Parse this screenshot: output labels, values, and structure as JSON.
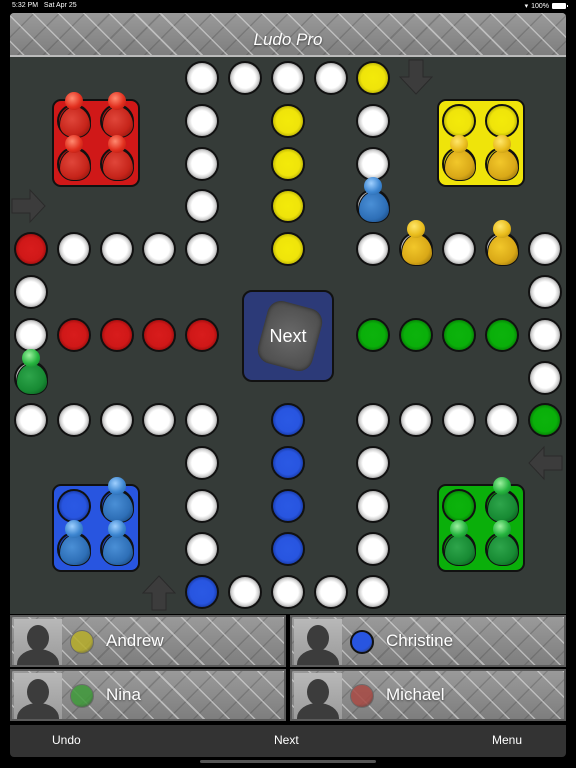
{
  "status_bar": {
    "time": "5:32 PM",
    "date": "Sat Apr 25",
    "battery": "100%",
    "wifi_icon": "wifi-icon",
    "battery_icon": "battery-icon"
  },
  "app": {
    "title": "Ludo Pro"
  },
  "colors": {
    "red": "#d01818",
    "yellow": "#efe40a",
    "green": "#0aaf0a",
    "blue": "#2855e0",
    "white": "#ffffff",
    "board": "#353b38",
    "dice_box": "#2c3a78"
  },
  "board": {
    "grid_size": 13,
    "cells": [
      {
        "col": 4,
        "row": 0,
        "color": "w"
      },
      {
        "col": 5,
        "row": 0,
        "color": "w"
      },
      {
        "col": 6,
        "row": 0,
        "color": "w"
      },
      {
        "col": 7,
        "row": 0,
        "color": "w"
      },
      {
        "col": 8,
        "row": 0,
        "color": "y"
      },
      {
        "col": 4,
        "row": 1,
        "color": "w"
      },
      {
        "col": 6,
        "row": 1,
        "color": "y"
      },
      {
        "col": 8,
        "row": 1,
        "color": "w"
      },
      {
        "col": 4,
        "row": 2,
        "color": "w"
      },
      {
        "col": 6,
        "row": 2,
        "color": "y"
      },
      {
        "col": 8,
        "row": 2,
        "color": "w"
      },
      {
        "col": 4,
        "row": 3,
        "color": "w"
      },
      {
        "col": 6,
        "row": 3,
        "color": "y"
      },
      {
        "col": 8,
        "row": 3,
        "color": "w"
      },
      {
        "col": 0,
        "row": 4,
        "color": "r"
      },
      {
        "col": 1,
        "row": 4,
        "color": "w"
      },
      {
        "col": 2,
        "row": 4,
        "color": "w"
      },
      {
        "col": 3,
        "row": 4,
        "color": "w"
      },
      {
        "col": 4,
        "row": 4,
        "color": "w"
      },
      {
        "col": 6,
        "row": 4,
        "color": "y"
      },
      {
        "col": 8,
        "row": 4,
        "color": "w"
      },
      {
        "col": 9,
        "row": 4,
        "color": "w"
      },
      {
        "col": 10,
        "row": 4,
        "color": "w"
      },
      {
        "col": 11,
        "row": 4,
        "color": "w"
      },
      {
        "col": 12,
        "row": 4,
        "color": "w"
      },
      {
        "col": 0,
        "row": 5,
        "color": "w"
      },
      {
        "col": 12,
        "row": 5,
        "color": "w"
      },
      {
        "col": 0,
        "row": 6,
        "color": "w"
      },
      {
        "col": 1,
        "row": 6,
        "color": "r"
      },
      {
        "col": 2,
        "row": 6,
        "color": "r"
      },
      {
        "col": 3,
        "row": 6,
        "color": "r"
      },
      {
        "col": 4,
        "row": 6,
        "color": "r"
      },
      {
        "col": 8,
        "row": 6,
        "color": "g"
      },
      {
        "col": 9,
        "row": 6,
        "color": "g"
      },
      {
        "col": 10,
        "row": 6,
        "color": "g"
      },
      {
        "col": 11,
        "row": 6,
        "color": "g"
      },
      {
        "col": 12,
        "row": 6,
        "color": "w"
      },
      {
        "col": 0,
        "row": 7,
        "color": "w"
      },
      {
        "col": 12,
        "row": 7,
        "color": "w"
      },
      {
        "col": 0,
        "row": 8,
        "color": "w"
      },
      {
        "col": 1,
        "row": 8,
        "color": "w"
      },
      {
        "col": 2,
        "row": 8,
        "color": "w"
      },
      {
        "col": 3,
        "row": 8,
        "color": "w"
      },
      {
        "col": 4,
        "row": 8,
        "color": "w"
      },
      {
        "col": 6,
        "row": 8,
        "color": "b"
      },
      {
        "col": 8,
        "row": 8,
        "color": "w"
      },
      {
        "col": 9,
        "row": 8,
        "color": "w"
      },
      {
        "col": 10,
        "row": 8,
        "color": "w"
      },
      {
        "col": 11,
        "row": 8,
        "color": "w"
      },
      {
        "col": 12,
        "row": 8,
        "color": "g"
      },
      {
        "col": 4,
        "row": 9,
        "color": "w"
      },
      {
        "col": 6,
        "row": 9,
        "color": "b"
      },
      {
        "col": 8,
        "row": 9,
        "color": "w"
      },
      {
        "col": 4,
        "row": 10,
        "color": "w"
      },
      {
        "col": 6,
        "row": 10,
        "color": "b"
      },
      {
        "col": 8,
        "row": 10,
        "color": "w"
      },
      {
        "col": 4,
        "row": 11,
        "color": "w"
      },
      {
        "col": 6,
        "row": 11,
        "color": "b"
      },
      {
        "col": 8,
        "row": 11,
        "color": "w"
      },
      {
        "col": 4,
        "row": 12,
        "color": "b"
      },
      {
        "col": 5,
        "row": 12,
        "color": "w"
      },
      {
        "col": 6,
        "row": 12,
        "color": "w"
      },
      {
        "col": 7,
        "row": 12,
        "color": "w"
      },
      {
        "col": 8,
        "row": 12,
        "color": "w"
      }
    ],
    "houses": [
      {
        "color": "red",
        "col": 1,
        "row": 1,
        "slots": [
          "r",
          "r",
          "r",
          "r"
        ]
      },
      {
        "color": "yellow",
        "col": 10,
        "row": 1,
        "slots": [
          "y",
          "y",
          "y",
          "y"
        ]
      },
      {
        "color": "blue",
        "col": 1,
        "row": 10,
        "slots": [
          "b",
          "b",
          "b",
          "b"
        ]
      },
      {
        "color": "green",
        "col": 10,
        "row": 10,
        "slots": [
          "g",
          "g",
          "g",
          "g"
        ]
      }
    ],
    "pawns": [
      {
        "color": "red",
        "col": 1,
        "row": 1
      },
      {
        "color": "red",
        "col": 2,
        "row": 1
      },
      {
        "color": "red",
        "col": 1,
        "row": 2
      },
      {
        "color": "red",
        "col": 2,
        "row": 2
      },
      {
        "color": "yellow",
        "col": 10,
        "row": 2
      },
      {
        "color": "yellow",
        "col": 11,
        "row": 2
      },
      {
        "color": "yellow",
        "col": 9,
        "row": 4
      },
      {
        "color": "yellow",
        "col": 11,
        "row": 4
      },
      {
        "color": "blue",
        "col": 8,
        "row": 3
      },
      {
        "color": "green",
        "col": 0,
        "row": 7
      },
      {
        "color": "blue",
        "col": 2,
        "row": 10
      },
      {
        "color": "blue",
        "col": 1,
        "row": 11
      },
      {
        "color": "blue",
        "col": 2,
        "row": 11
      },
      {
        "color": "green",
        "col": 11,
        "row": 10
      },
      {
        "color": "green",
        "col": 10,
        "row": 11
      },
      {
        "color": "green",
        "col": 11,
        "row": 11
      }
    ],
    "start_arrows": [
      {
        "direction": "right",
        "name": "red-start-arrow-icon"
      },
      {
        "direction": "down",
        "name": "yellow-start-arrow-icon"
      },
      {
        "direction": "left",
        "name": "green-start-arrow-icon"
      },
      {
        "direction": "up",
        "name": "blue-start-arrow-icon"
      }
    ],
    "dice": {
      "label": "Next"
    }
  },
  "players": [
    {
      "name": "Andrew",
      "color": "yellow",
      "chip": "#b7ae2a",
      "active": false
    },
    {
      "name": "Christine",
      "color": "blue",
      "chip": "#2855e0",
      "active": true
    },
    {
      "name": "Nina",
      "color": "green",
      "chip": "#3f9a3a",
      "active": false
    },
    {
      "name": "Michael",
      "color": "red",
      "chip": "#a84a44",
      "active": false
    }
  ],
  "footer": {
    "undo_label": "Undo",
    "next_label": "Next",
    "menu_label": "Menu"
  }
}
